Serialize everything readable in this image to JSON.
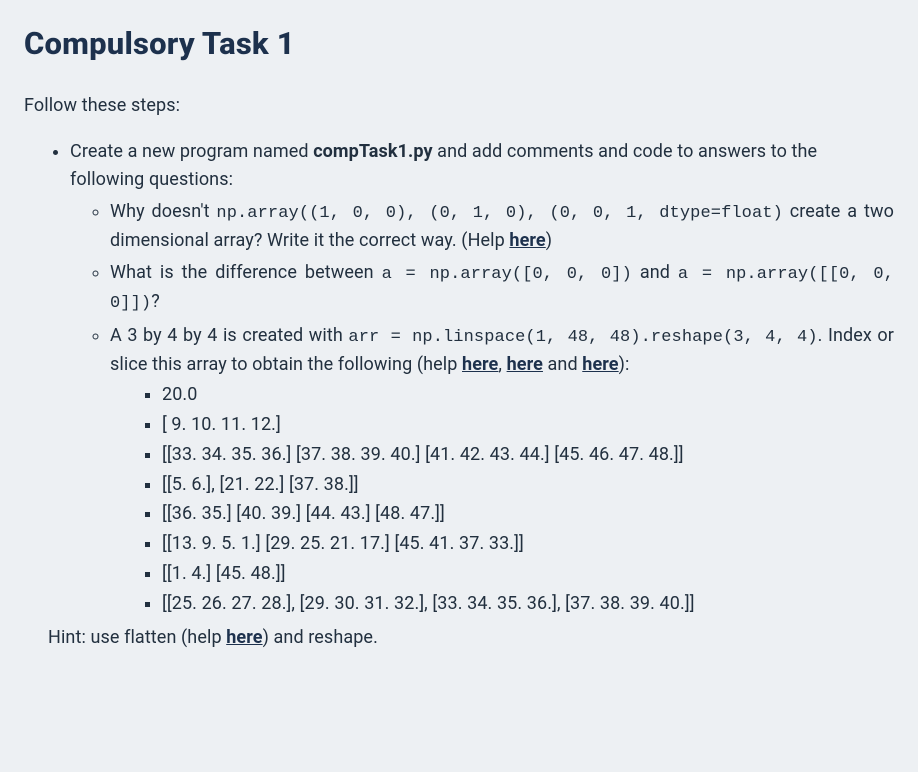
{
  "title": "Compulsory Task 1",
  "intro": "Follow these steps:",
  "bullet1": {
    "pre": "Create a new program named ",
    "filename": "compTask1.py",
    "post": " and add comments and code to answers to the following questions:"
  },
  "q1": {
    "seg1": "Why doesn't ",
    "code": "np.array((1, 0, 0), (0, 1, 0), (0, 0, 1, dtype=float)",
    "seg2": " create a two dimensional array? Write it the correct way. (Help ",
    "link": "here",
    "seg3": ")"
  },
  "q2": {
    "seg1": "What is the difference between ",
    "code1": "a = np.array([0, 0, 0])",
    "seg2": " and ",
    "code2": "a = np.array([[0, 0, 0]])",
    "seg3": "?"
  },
  "q3": {
    "seg1": "A 3 by 4 by 4 is created with ",
    "code": "arr = np.linspace(1, 48, 48).reshape(3, 4, 4)",
    "seg2": ". Index or slice this array to obtain the following (help ",
    "link1": "here",
    "sep1": ", ",
    "link2": "here",
    "sep2": " and ",
    "link3": "here",
    "seg3": "):"
  },
  "outputs": [
    "20.0",
    "[ 9. 10. 11. 12.]",
    "[[33. 34. 35. 36.] [37. 38. 39. 40.] [41. 42. 43. 44.] [45. 46. 47. 48.]]",
    "[[5. 6.], [21. 22.] [37. 38.]]",
    "[[36. 35.] [40. 39.] [44. 43.] [48. 47.]]",
    "[[13. 9. 5. 1.] [29. 25. 21. 17.] [45. 41. 37. 33.]]",
    "[[1. 4.] [45. 48.]]",
    "[[25. 26. 27. 28.], [29. 30. 31. 32.], [33. 34. 35. 36.], [37. 38. 39. 40.]]"
  ],
  "hint": {
    "seg1": "Hint: use flatten (help ",
    "link": "here",
    "seg2": ") and reshape."
  }
}
